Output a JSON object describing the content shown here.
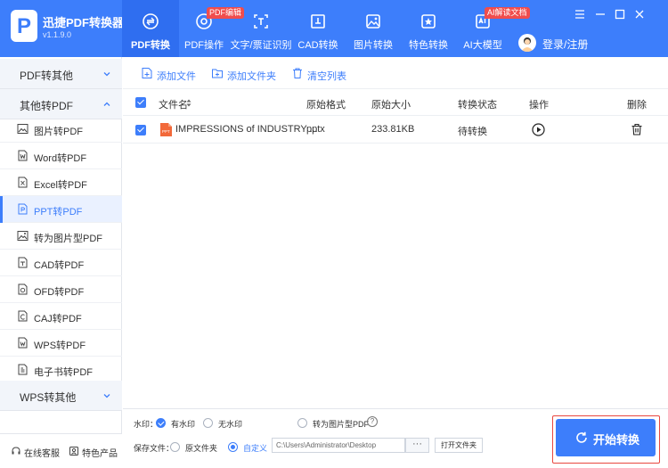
{
  "app": {
    "name": "迅捷PDF转换器",
    "version": "v1.1.9.0",
    "logo_letter": "P"
  },
  "nav": [
    {
      "label": "PDF转换",
      "icon": "convert-icon",
      "active": true
    },
    {
      "label": "PDF操作",
      "icon": "disc-icon",
      "badge": "PDF编辑"
    },
    {
      "label": "文字/票证识别",
      "icon": "scan-icon"
    },
    {
      "label": "CAD转换",
      "icon": "cad-icon"
    },
    {
      "label": "图片转换",
      "icon": "image-icon"
    },
    {
      "label": "特色转换",
      "icon": "star-icon"
    },
    {
      "label": "AI大模型",
      "icon": "ai-icon",
      "badge": "AI解读文档"
    }
  ],
  "login_label": "登录/注册",
  "sidebar": {
    "groups": [
      {
        "label": "PDF转其他"
      },
      {
        "label": "其他转PDF"
      },
      {
        "label": "WPS转其他"
      }
    ],
    "items": [
      {
        "label": "图片转PDF",
        "icon": "image-icon"
      },
      {
        "label": "Word转PDF",
        "icon": "word-icon"
      },
      {
        "label": "Excel转PDF",
        "icon": "excel-icon"
      },
      {
        "label": "PPT转PDF",
        "icon": "ppt-icon",
        "active": true
      },
      {
        "label": "转为图片型PDF",
        "icon": "image-pdf-icon"
      },
      {
        "label": "CAD转PDF",
        "icon": "cad-icon"
      },
      {
        "label": "OFD转PDF",
        "icon": "ofd-icon"
      },
      {
        "label": "CAJ转PDF",
        "icon": "caj-icon"
      },
      {
        "label": "WPS转PDF",
        "icon": "wps-icon"
      },
      {
        "label": "电子书转PDF",
        "icon": "ebook-icon"
      }
    ],
    "footer": {
      "service": "在线客服",
      "products": "特色产品"
    }
  },
  "toolbar": {
    "add_file": "添加文件",
    "add_folder": "添加文件夹",
    "clear_list": "清空列表"
  },
  "table": {
    "headers": {
      "name": "文件名",
      "format": "原始格式",
      "size": "原始大小",
      "status": "转换状态",
      "action": "操作",
      "delete": "删除"
    },
    "rows": [
      {
        "name": "IMPRESSIONS of INDUSTRY ...",
        "format": "pptx",
        "size": "233.81KB",
        "status": "待转换"
      }
    ]
  },
  "options": {
    "watermark_label": "水印：",
    "with_watermark": "有水印",
    "no_watermark": "无水印",
    "to_image_pdf": "转为图片型PDF",
    "help_glyph": "?",
    "save_label": "保存文件：",
    "source_folder": "原文件夹",
    "custom": "自定义",
    "path": "C:\\Users\\Administrator\\Desktop",
    "browse": "···",
    "open_folder": "打开文件夹"
  },
  "start_button": "开始转换",
  "colors": {
    "primary": "#3d7efb",
    "badge": "#f04d4d",
    "highlight_frame": "#e8473f"
  }
}
